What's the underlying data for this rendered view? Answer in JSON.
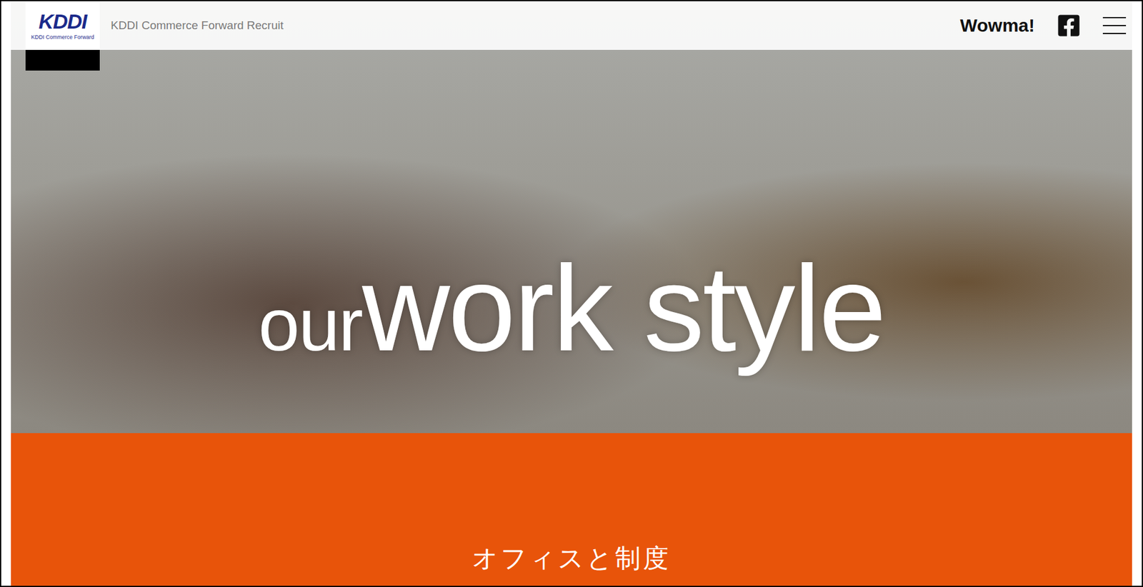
{
  "header": {
    "logo": {
      "mark": "KDDI",
      "caption": "KDDI Commerce Forward"
    },
    "site_title": "KDDI Commerce Forward Recruit",
    "brand_link": "Wowma!"
  },
  "hero": {
    "lead": "our",
    "headline": "work style"
  },
  "section": {
    "title": "オフィスと制度"
  }
}
